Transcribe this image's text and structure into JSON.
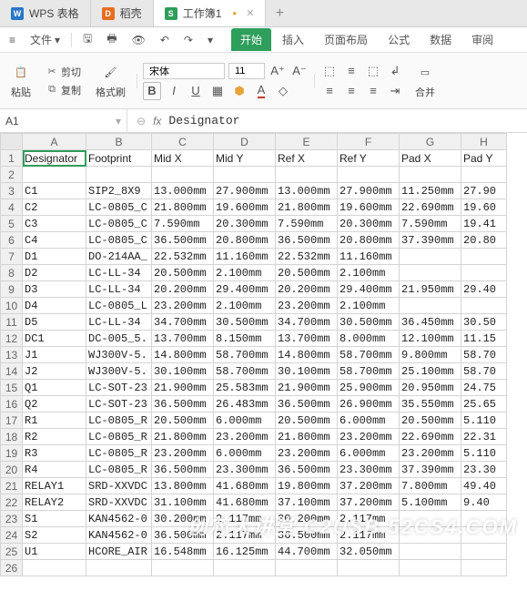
{
  "tabs": [
    {
      "icon": "W",
      "iconColor": "#2b77c7",
      "label": "WPS 表格"
    },
    {
      "icon": "D",
      "iconColor": "#e86e1f",
      "label": "稻壳"
    },
    {
      "icon": "S",
      "iconColor": "#2e9e5b",
      "label": "工作簿1",
      "active": true
    }
  ],
  "menu": {
    "file": "文件",
    "undo": "↶",
    "redo": "↷"
  },
  "ribbonTabs": [
    "开始",
    "插入",
    "页面布局",
    "公式",
    "数据",
    "审阅"
  ],
  "ribbon": {
    "paste": "粘贴",
    "cut": "剪切",
    "copy": "复制",
    "painter": "格式刷",
    "font": "宋体",
    "size": "11",
    "wrap": "合并"
  },
  "nameBox": "A1",
  "formula": "Designator",
  "cols": [
    "A",
    "B",
    "C",
    "D",
    "E",
    "F",
    "G",
    "H"
  ],
  "header": [
    "Designator",
    "Footprint",
    "Mid X",
    "Mid Y",
    "Ref X",
    "Ref Y",
    "Pad X",
    "Pad Y"
  ],
  "rows": [
    [
      "C1",
      "SIP2_8X9",
      "13.000mm",
      "27.900mm",
      "13.000mm",
      "27.900mm",
      "11.250mm",
      "27.90"
    ],
    [
      "C2",
      "LC-0805_C",
      "21.800mm",
      "19.600mm",
      "21.800mm",
      "19.600mm",
      "22.690mm",
      "19.60"
    ],
    [
      "C3",
      "LC-0805_C",
      "7.590mm",
      "20.300mm",
      "7.590mm",
      "20.300mm",
      "7.590mm",
      "19.41"
    ],
    [
      "C4",
      "LC-0805_C",
      "36.500mm",
      "20.800mm",
      "36.500mm",
      "20.800mm",
      "37.390mm",
      "20.80"
    ],
    [
      "D1",
      "DO-214AA_",
      "22.532mm",
      "11.160mm",
      "22.532mm",
      "11.160mm",
      "",
      ""
    ],
    [
      "D2",
      "LC-LL-34",
      "20.500mm",
      "2.100mm",
      "20.500mm",
      "2.100mm",
      "",
      ""
    ],
    [
      "D3",
      "LC-LL-34",
      "20.200mm",
      "29.400mm",
      "20.200mm",
      "29.400mm",
      "21.950mm",
      "29.40"
    ],
    [
      "D4",
      "LC-0805_L",
      "23.200mm",
      "2.100mm",
      "23.200mm",
      "2.100mm",
      "",
      ""
    ],
    [
      "D5",
      "LC-LL-34",
      "34.700mm",
      "30.500mm",
      "34.700mm",
      "30.500mm",
      "36.450mm",
      "30.50"
    ],
    [
      "DC1",
      "DC-005_5.",
      "13.700mm",
      "8.150mm",
      "13.700mm",
      "8.000mm",
      "12.100mm",
      "11.15"
    ],
    [
      "J1",
      "WJ300V-5.",
      "14.800mm",
      "58.700mm",
      "14.800mm",
      "58.700mm",
      "9.800mm",
      "58.70"
    ],
    [
      "J2",
      "WJ300V-5.",
      "30.100mm",
      "58.700mm",
      "30.100mm",
      "58.700mm",
      "25.100mm",
      "58.70"
    ],
    [
      "Q1",
      "LC-SOT-23",
      "21.900mm",
      "25.583mm",
      "21.900mm",
      "25.900mm",
      "20.950mm",
      "24.75"
    ],
    [
      "Q2",
      "LC-SOT-23",
      "36.500mm",
      "26.483mm",
      "36.500mm",
      "26.900mm",
      "35.550mm",
      "25.65"
    ],
    [
      "R1",
      "LC-0805_R",
      "20.500mm",
      "6.000mm",
      "20.500mm",
      "6.000mm",
      "20.500mm",
      "5.110"
    ],
    [
      "R2",
      "LC-0805_R",
      "21.800mm",
      "23.200mm",
      "21.800mm",
      "23.200mm",
      "22.690mm",
      "22.31"
    ],
    [
      "R3",
      "LC-0805_R",
      "23.200mm",
      "6.000mm",
      "23.200mm",
      "6.000mm",
      "23.200mm",
      "5.110"
    ],
    [
      "R4",
      "LC-0805_R",
      "36.500mm",
      "23.300mm",
      "36.500mm",
      "23.300mm",
      "37.390mm",
      "23.30"
    ],
    [
      "RELAY1",
      "SRD-XXVDC",
      "13.800mm",
      "41.680mm",
      "19.800mm",
      "37.200mm",
      "7.800mm",
      "49.40"
    ],
    [
      "RELAY2",
      "SRD-XXVDC",
      "31.100mm",
      "41.680mm",
      "37.100mm",
      "37.200mm",
      "5.100mm",
      "9.40"
    ],
    [
      "S1",
      "KAN4562-0",
      "30.200mm",
      "2.117mm",
      "30.200mm",
      "2.117mm",
      "",
      ""
    ],
    [
      "S2",
      "KAN4562-0",
      "36.500mm",
      "2.117mm",
      "36.500mm",
      "2.117mm",
      "",
      ""
    ],
    [
      "U1",
      "HCORE_AIR",
      "16.548mm",
      "16.125mm",
      "44.700mm",
      "32.050mm",
      "",
      ""
    ]
  ],
  "watermark": "创芯大讲堂 C2USB.52CS4.COM"
}
